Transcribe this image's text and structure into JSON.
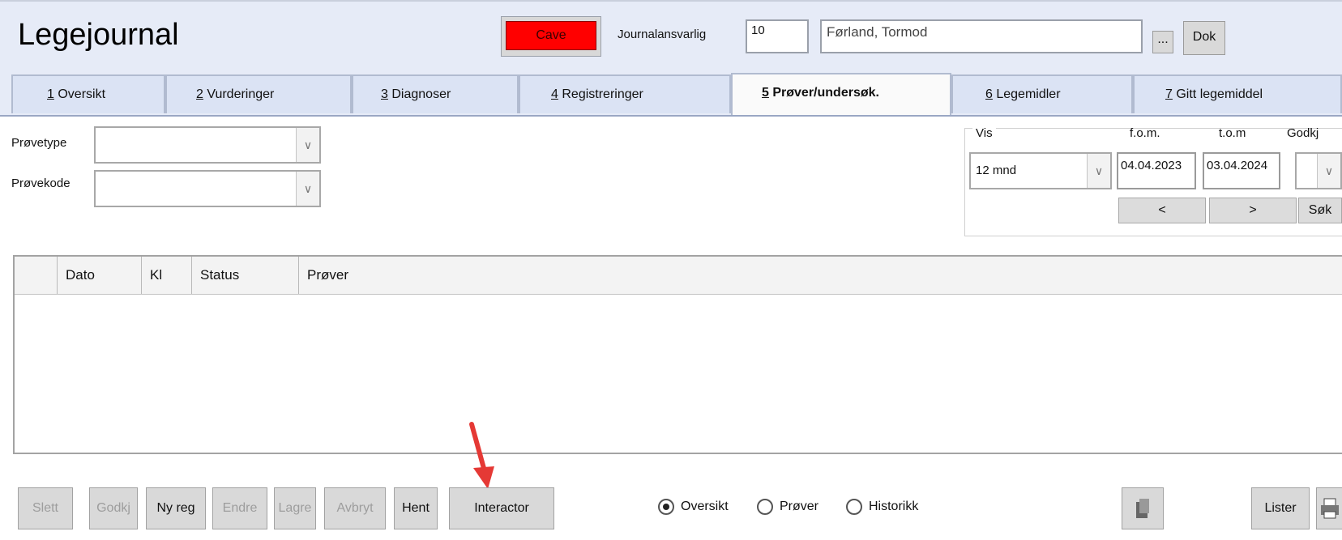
{
  "header": {
    "title": "Legejournal",
    "cave_label": "Cave",
    "cave_color": "#ff0000",
    "journal_responsible_label": "Journalansvarlig",
    "journal_responsible_id": "10",
    "journal_responsible_name": "Førland, Tormod",
    "ellipsis_label": "...",
    "dok_label": "Dok"
  },
  "tabs": [
    {
      "key": "1",
      "label": "Oversikt",
      "active": false
    },
    {
      "key": "2",
      "label": "Vurderinger",
      "active": false
    },
    {
      "key": "3",
      "label": "Diagnoser",
      "active": false
    },
    {
      "key": "4",
      "label": "Registreringer",
      "active": false
    },
    {
      "key": "5",
      "label": "Prøver/undersøk.",
      "active": true
    },
    {
      "key": "6",
      "label": "Legemidler",
      "active": false
    },
    {
      "key": "7",
      "label": "Gitt legemiddel",
      "active": false
    }
  ],
  "filters": {
    "provetype_label": "Prøvetype",
    "provetype_value": "",
    "provekode_label": "Prøvekode",
    "provekode_value": ""
  },
  "period": {
    "vis_label": "Vis",
    "vis_value": "12 mnd",
    "fom_label": "f.o.m.",
    "fom_value": "04.04.2023",
    "tom_label": "t.o.m",
    "tom_value": "03.04.2024",
    "godkj_label": "Godkj",
    "godkj_value": "",
    "prev_label": "<",
    "next_label": ">",
    "search_label": "Søk"
  },
  "table": {
    "columns": [
      "Dato",
      "Kl",
      "Status",
      "Prøver"
    ],
    "rows": []
  },
  "toolbar": {
    "slett": "Slett",
    "godkj": "Godkj",
    "ny_reg": "Ny reg",
    "endre": "Endre",
    "lagre": "Lagre",
    "avbryt": "Avbryt",
    "hent": "Hent",
    "interactor": "Interactor",
    "lister": "Lister"
  },
  "view_mode": {
    "options": [
      "Oversikt",
      "Prøver",
      "Historikk"
    ],
    "selected": "Oversikt"
  },
  "annotation": {
    "arrow_color": "#e53935"
  }
}
